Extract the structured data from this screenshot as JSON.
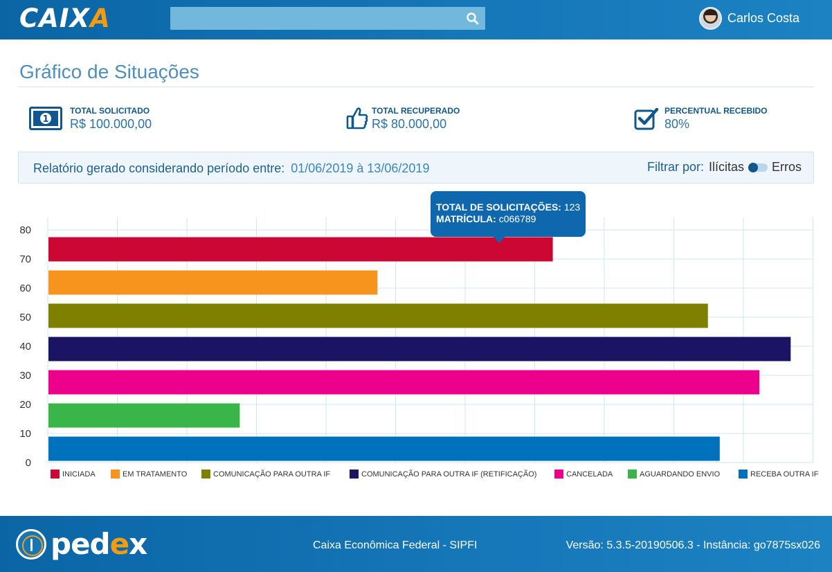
{
  "header": {
    "logo_text_a": "CAIX",
    "logo_text_b": "A",
    "search": {
      "placeholder": "",
      "value": ""
    },
    "user_name": "Carlos Costa"
  },
  "page": {
    "title": "Gráfico de Situações"
  },
  "stats": [
    {
      "label": "TOTAL SOLICITADO",
      "value": "R$ 100.000,00",
      "icon": "money-bill-icon"
    },
    {
      "label": "TOTAL RECUPERADO",
      "value": "R$ 80.000,00",
      "icon": "thumbs-up-icon"
    },
    {
      "label": "PERCENTUAL RECEBIDO",
      "value": "80%",
      "icon": "check-square-icon"
    }
  ],
  "report": {
    "period_label": "Relatório gerado considerando período entre:",
    "period_value": "01/06/2019 à 13/06/2019",
    "filter_label": "Filtrar por:",
    "filter_option_a": "Ilícitas",
    "filter_option_b": "Erros"
  },
  "tooltip": {
    "total_label": "TOTAL DE SOLICITAÇÕES:",
    "total_value": "123",
    "matricula_label": "MATRÍCULA:",
    "matricula_value": "c066789"
  },
  "chart_data": {
    "type": "bar",
    "orientation": "horizontal",
    "ylim": [
      0,
      80
    ],
    "yticks": [
      0,
      10,
      20,
      30,
      40,
      50,
      60,
      70,
      80
    ],
    "grid": true,
    "legend_position": "bottom",
    "categories": [
      "INICIADA",
      "EM TRATAMENTO",
      "COMUNICAÇÃO PARA OUTRA IF",
      "COMUNICAÇÃO PARA OUTRA IF (RETIFICAÇÃO)",
      "CANCELADA",
      "AGUARDANDO ENVIO",
      "RECEBA OUTRA IF"
    ],
    "values": [
      72.5,
      47.3,
      94.8,
      106.7,
      102.2,
      27.5,
      96.5
    ],
    "colors": [
      "#cc0733",
      "#f7941d",
      "#808000",
      "#1b1464",
      "#ec008c",
      "#39b54a",
      "#0071bc"
    ]
  },
  "footer": {
    "brand_a": "ped",
    "brand_b": "e",
    "brand_c": "x",
    "org": "Caixa Econômica Federal - SIPFI",
    "version": "Versão: 5.3.5-20190506.3 - Instância: go7875sx026"
  }
}
